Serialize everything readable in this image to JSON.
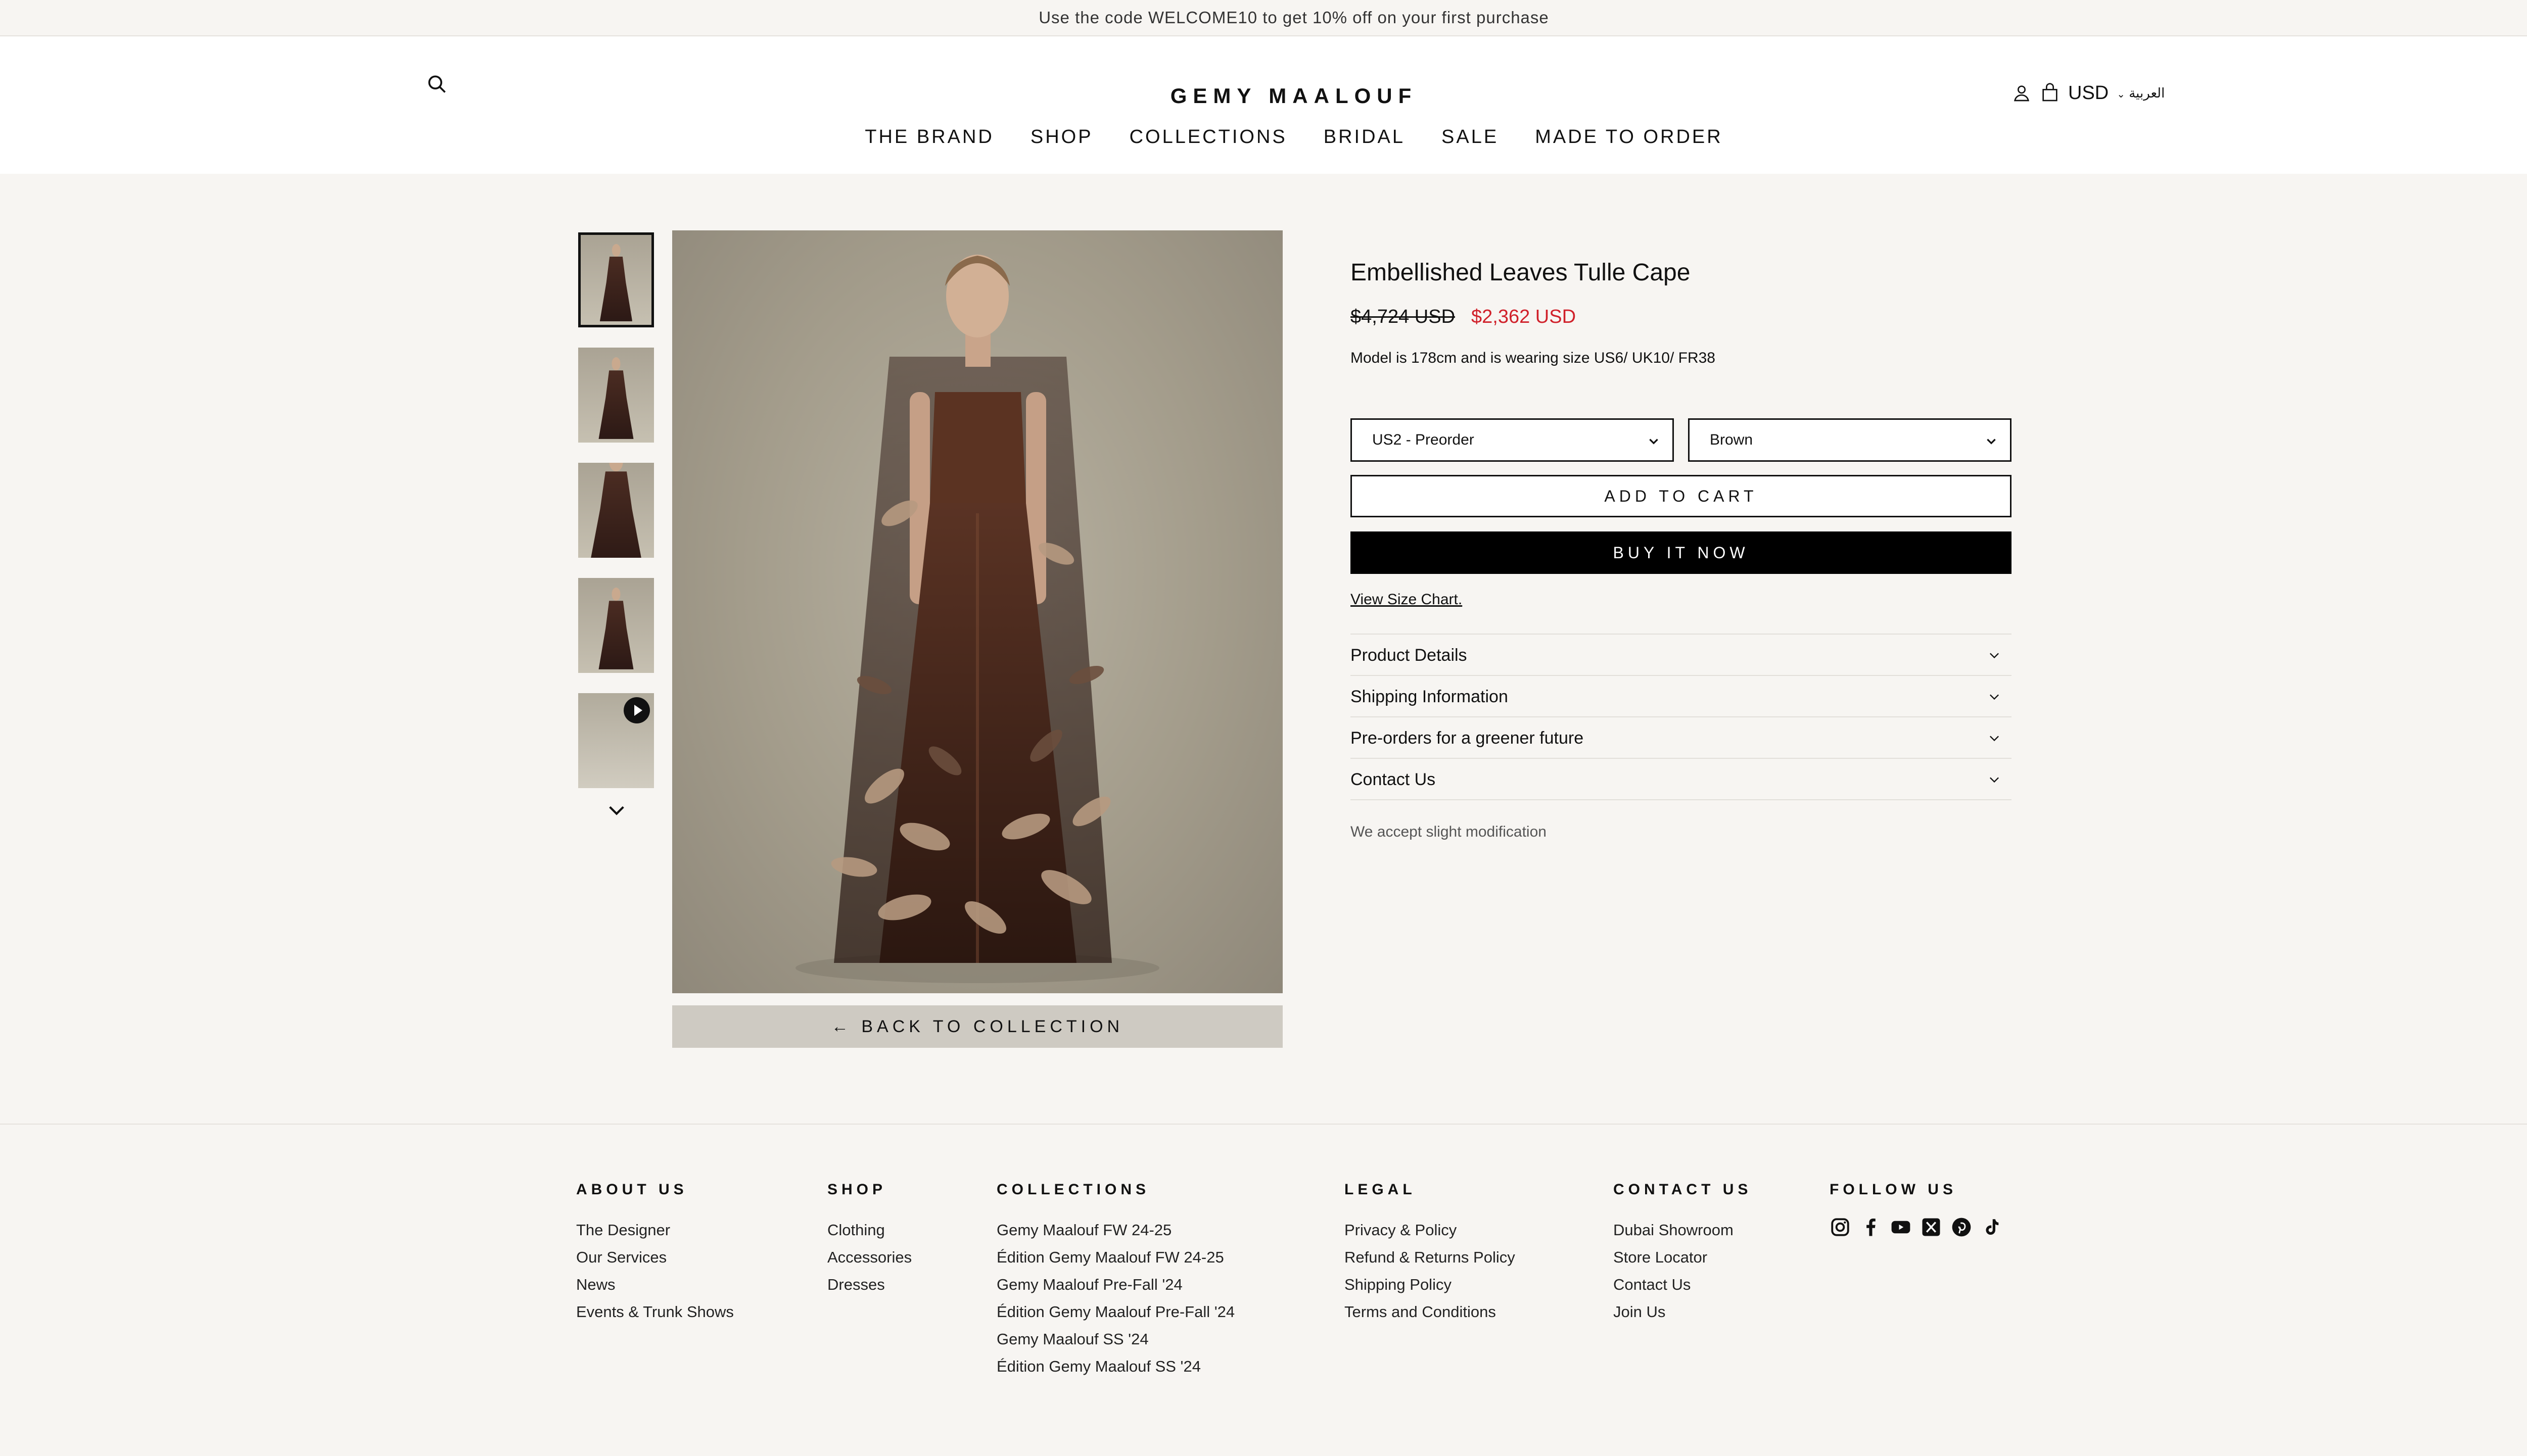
{
  "announcement": "Use the code WELCOME10 to get 10% off on your first purchase",
  "header": {
    "logo": "GEMY MAALOUF",
    "currency": "USD",
    "language": "العربية",
    "nav": [
      "THE BRAND",
      "SHOP",
      "COLLECTIONS",
      "BRIDAL",
      "SALE",
      "MADE TO ORDER"
    ]
  },
  "gallery": {
    "back_label": "← BACK TO COLLECTION",
    "thumbnails": [
      "image-1",
      "image-2",
      "image-3",
      "image-4",
      "video-5"
    ]
  },
  "product": {
    "title": "Embellished Leaves Tulle Cape",
    "price_old": "$4,724 USD",
    "price_new": "$2,362 USD",
    "model_note": "Model is 178cm and is wearing size US6/ UK10/ FR38",
    "size_value": "US2 - Preorder",
    "color_value": "Brown",
    "add_to_cart": "ADD TO CART",
    "buy_now": "BUY IT NOW",
    "size_chart": "View Size Chart.",
    "accordion": [
      "Product Details",
      "Shipping Information",
      "Pre-orders for a greener future",
      "Contact Us"
    ],
    "modification_note": "We accept slight modification"
  },
  "footer": {
    "about": {
      "heading": "ABOUT US",
      "links": [
        "The Designer",
        "Our Services",
        "News",
        "Events & Trunk Shows"
      ]
    },
    "shop": {
      "heading": "SHOP",
      "links": [
        "Clothing",
        "Accessories",
        "Dresses"
      ]
    },
    "collections": {
      "heading": "COLLECTIONS",
      "links": [
        "Gemy Maalouf FW 24-25",
        "Édition Gemy Maalouf FW 24-25",
        "Gemy Maalouf Pre-Fall '24",
        "Édition Gemy Maalouf Pre-Fall '24",
        "Gemy Maalouf SS '24",
        "Édition Gemy Maalouf SS '24"
      ]
    },
    "legal": {
      "heading": "LEGAL",
      "links": [
        "Privacy & Policy",
        "Refund & Returns Policy",
        "Shipping Policy",
        "Terms and Conditions"
      ]
    },
    "contact": {
      "heading": "CONTACT US",
      "links": [
        "Dubai Showroom",
        "Store Locator",
        "Contact Us",
        "Join Us"
      ]
    },
    "follow": {
      "heading": "FOLLOW US",
      "icons": [
        "instagram-icon",
        "facebook-icon",
        "youtube-icon",
        "x-icon",
        "pinterest-icon",
        "tiktok-icon"
      ]
    }
  },
  "colors": {
    "sale_red": "#d0202a",
    "background": "#f7f5f2",
    "button_black": "#000000",
    "back_button_bg": "#cecac2"
  }
}
